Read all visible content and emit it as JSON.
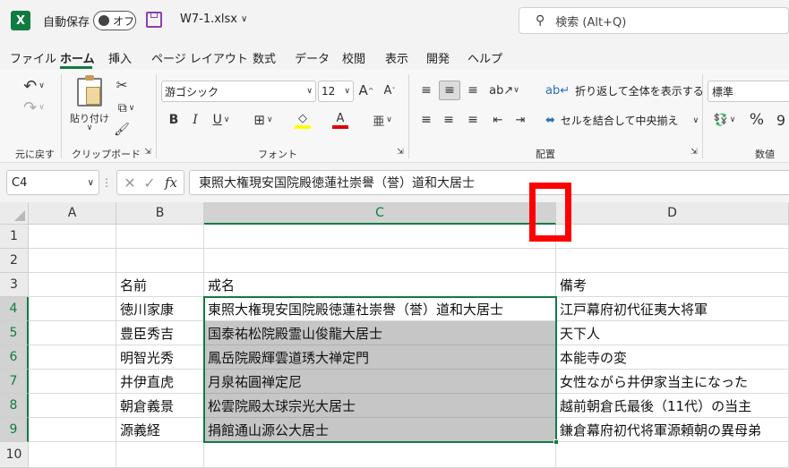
{
  "title": {
    "autosave_label": "自動保存",
    "autosave_state": "オフ",
    "filename": "W7-1.xlsx",
    "search_placeholder": "検索 (Alt+Q)"
  },
  "menu_tabs": [
    "ファイル",
    "ホーム",
    "挿入",
    "ページ レイアウト",
    "数式",
    "データ",
    "校閲",
    "表示",
    "開発",
    "ヘルプ"
  ],
  "ribbon": {
    "undo_group": "元に戻す",
    "paste_label": "貼り付け",
    "clipboard_group": "クリップボード",
    "font_name": "游ゴシック",
    "font_size": "12",
    "font_group": "フォント",
    "bold": "B",
    "italic": "I",
    "underline": "U",
    "wrap_text": "折り返して全体を表示する",
    "merge_center": "セルを結合して中央揃え",
    "alignment_group": "配置",
    "number_format": "標準",
    "percent": "%",
    "number_group": "数値",
    "fx": "fx"
  },
  "formula_bar": {
    "name_box": "C4",
    "content": "東照大権現安国院殿徳蓮社崇譽（誉）道和大居士"
  },
  "columns": [
    "A",
    "B",
    "C",
    "D"
  ],
  "rows": [
    "1",
    "2",
    "3",
    "4",
    "5",
    "6",
    "7",
    "8",
    "9",
    "10"
  ],
  "cells": {
    "headers": [
      "名前",
      "戒名",
      "備考"
    ],
    "data": [
      [
        "徳川家康",
        "東照大権現安国院殿徳蓮社崇譽（誉）道和大居士",
        "江戸幕府初代征夷大将軍"
      ],
      [
        "豊臣秀吉",
        "国泰祐松院殿霊山俊龍大居士",
        "天下人"
      ],
      [
        "明智光秀",
        "鳳岳院殿輝雲道琇大禅定門",
        "本能寺の変"
      ],
      [
        "井伊直虎",
        "月泉祐圓禅定尼",
        "女性ながら井伊家当主になった"
      ],
      [
        "朝倉義景",
        "松雲院殿太球宗光大居士",
        "越前朝倉氏最後（11代）の当主"
      ],
      [
        "源義経",
        "捐館通山源公大居士",
        "鎌倉幕府初代将軍源頼朝の異母弟"
      ]
    ]
  },
  "colors": {
    "excel_green": "#107c41",
    "selection_fill": "#c6c6c6",
    "annotation_red": "#ff0000"
  }
}
